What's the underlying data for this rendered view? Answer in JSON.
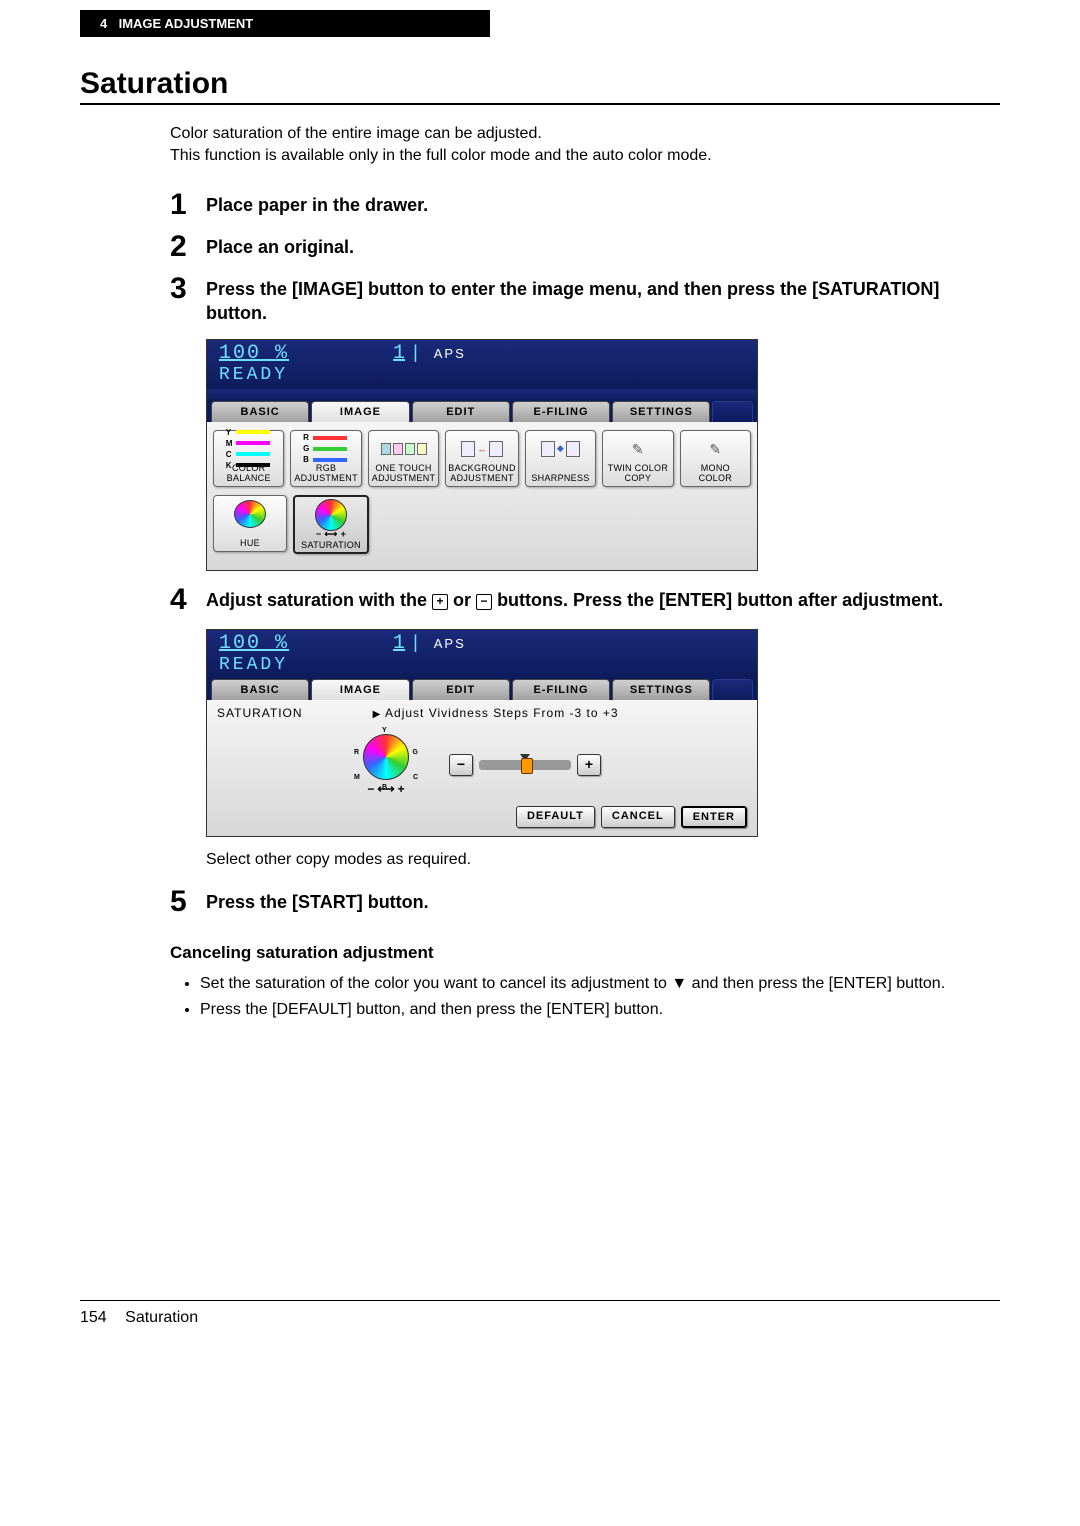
{
  "header": {
    "chapter_num": "4",
    "chapter_title": "IMAGE ADJUSTMENT"
  },
  "title": "Saturation",
  "intro": [
    "Color saturation of the entire image can be adjusted.",
    "This function is available only in the full color mode and the auto color mode."
  ],
  "steps": {
    "s1": {
      "num": "1",
      "text": "Place paper in the drawer."
    },
    "s2": {
      "num": "2",
      "text": "Place an original."
    },
    "s3": {
      "num": "3",
      "text": "Press the [IMAGE] button to enter the image menu, and then press the [SATURATION] button."
    },
    "s4": {
      "num": "4",
      "prefix": "Adjust saturation with the ",
      "mid": " or ",
      "suffix": " buttons. Press the [ENTER] button after adjustment."
    },
    "s4_note": "Select other copy modes as required.",
    "s5": {
      "num": "5",
      "text": "Press the [START] button."
    }
  },
  "cancel": {
    "heading": "Canceling saturation adjustment",
    "b1a": "Set the saturation of the color you want to cancel its adjustment to ",
    "b1b": " and then press the [ENTER] button.",
    "b2": "Press the [DEFAULT] button, and then press the [ENTER] button."
  },
  "screen1": {
    "status": {
      "pct": "100",
      "pct_unit": "%",
      "count": "1",
      "aps": "APS",
      "ready": "READY"
    },
    "tabs": {
      "basic": "BASIC",
      "image": "IMAGE",
      "edit": "EDIT",
      "efiling": "E-FILING",
      "settings": "SETTINGS"
    },
    "btns": {
      "color_balance": "COLOR BALANCE",
      "rgb": "RGB\nADJUSTMENT",
      "one_touch": "ONE TOUCH\nADJUSTMENT",
      "background": "BACKGROUND\nADJUSTMENT",
      "sharpness": "SHARPNESS",
      "twin": "TWIN COLOR\nCOPY",
      "mono": "MONO COLOR",
      "hue": "HUE",
      "saturation": "SATURATION"
    },
    "ymck": {
      "y": "Y",
      "m": "M",
      "c": "C",
      "k": "K"
    },
    "rgb_lbl": {
      "r": "R",
      "g": "G",
      "b": "B"
    }
  },
  "screen2": {
    "status": {
      "pct": "100",
      "pct_unit": "%",
      "count": "1",
      "aps": "APS",
      "ready": "READY"
    },
    "tabs": {
      "basic": "BASIC",
      "image": "IMAGE",
      "edit": "EDIT",
      "efiling": "E-FILING",
      "settings": "SETTINGS"
    },
    "sat_label": "SATURATION",
    "instruction": "Adjust Vividness Steps From -3 to +3",
    "minus": "−",
    "plus": "+",
    "actions": {
      "default": "DEFAULT",
      "cancel": "CANCEL",
      "enter": "ENTER"
    }
  },
  "footer": {
    "page": "154",
    "name": "Saturation"
  }
}
